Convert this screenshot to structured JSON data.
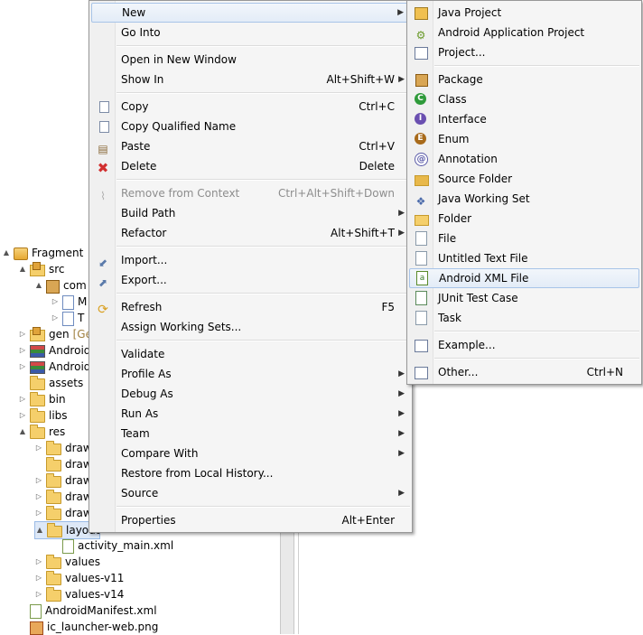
{
  "tree": {
    "rows": [
      {
        "label": "Fragment",
        "twisty": "▲",
        "icon": "project-icon"
      },
      {
        "label": "src",
        "twisty": "▲",
        "icon": "source-folder-icon"
      },
      {
        "label": "com",
        "twisty": "▲",
        "icon": "package-icon"
      },
      {
        "label": "M",
        "twisty": "▷",
        "icon": "java-file-icon"
      },
      {
        "label": "T",
        "twisty": "▷",
        "icon": "java-file-icon"
      },
      {
        "label": "gen",
        "suffix": "[Ge",
        "twisty": "▷",
        "icon": "source-folder-icon"
      },
      {
        "label": "Android",
        "twisty": "▷",
        "icon": "library-icon"
      },
      {
        "label": "Android",
        "twisty": "▷",
        "icon": "library-icon"
      },
      {
        "label": "assets",
        "twisty": "",
        "icon": "folder-icon"
      },
      {
        "label": "bin",
        "twisty": "▷",
        "icon": "folder-icon"
      },
      {
        "label": "libs",
        "twisty": "▷",
        "icon": "folder-icon"
      },
      {
        "label": "res",
        "twisty": "▲",
        "icon": "folder-icon"
      },
      {
        "label": "draw",
        "twisty": "▷",
        "icon": "folder-icon"
      },
      {
        "label": "draw",
        "twisty": "",
        "icon": "folder-icon"
      },
      {
        "label": "draw",
        "twisty": "▷",
        "icon": "folder-icon"
      },
      {
        "label": "draw",
        "twisty": "▷",
        "icon": "folder-icon"
      },
      {
        "label": "draw",
        "twisty": "▷",
        "icon": "folder-icon"
      },
      {
        "label": "layout",
        "twisty": "▲",
        "icon": "folder-icon"
      },
      {
        "label": "activity_main.xml",
        "twisty": "",
        "icon": "xml-file-icon"
      },
      {
        "label": "values",
        "twisty": "▷",
        "icon": "folder-icon"
      },
      {
        "label": "values-v11",
        "twisty": "▷",
        "icon": "folder-icon"
      },
      {
        "label": "values-v14",
        "twisty": "▷",
        "icon": "folder-icon"
      },
      {
        "label": "AndroidManifest.xml",
        "twisty": "",
        "icon": "xml-file-icon"
      },
      {
        "label": "ic_launcher-web.png",
        "twisty": "",
        "icon": "png-file-icon"
      }
    ]
  },
  "context_menu": {
    "items": {
      "new": {
        "label": "New",
        "has_submenu": true
      },
      "go_into": {
        "label": "Go Into"
      },
      "open_new_window": {
        "label": "Open in New Window"
      },
      "show_in": {
        "label": "Show In",
        "shortcut": "Alt+Shift+W"
      },
      "copy": {
        "label": "Copy",
        "shortcut": "Ctrl+C",
        "icon": "copy-icon"
      },
      "copy_qualified": {
        "label": "Copy Qualified Name",
        "icon": "copy-qualified-icon"
      },
      "paste": {
        "label": "Paste",
        "shortcut": "Ctrl+V",
        "icon": "paste-icon"
      },
      "delete": {
        "label": "Delete",
        "shortcut": "Delete",
        "icon": "delete-icon"
      },
      "remove_context": {
        "label": "Remove from Context",
        "shortcut": "Ctrl+Alt+Shift+Down",
        "disabled": true,
        "icon": "remove-context-icon"
      },
      "build_path": {
        "label": "Build Path"
      },
      "refactor": {
        "label": "Refactor",
        "shortcut": "Alt+Shift+T"
      },
      "import": {
        "label": "Import...",
        "icon": "import-icon"
      },
      "export": {
        "label": "Export...",
        "icon": "export-icon"
      },
      "refresh": {
        "label": "Refresh",
        "shortcut": "F5",
        "icon": "refresh-icon"
      },
      "assign_sets": {
        "label": "Assign Working Sets..."
      },
      "validate": {
        "label": "Validate"
      },
      "profile_as": {
        "label": "Profile As"
      },
      "debug_as": {
        "label": "Debug As"
      },
      "run_as": {
        "label": "Run As"
      },
      "team": {
        "label": "Team"
      },
      "compare_with": {
        "label": "Compare With"
      },
      "restore_history": {
        "label": "Restore from Local History..."
      },
      "source": {
        "label": "Source"
      },
      "properties": {
        "label": "Properties",
        "shortcut": "Alt+Enter"
      }
    }
  },
  "submenu_new": {
    "items": {
      "java_project": {
        "label": "Java Project"
      },
      "android_app_project": {
        "label": "Android Application Project"
      },
      "project": {
        "label": "Project..."
      },
      "package": {
        "label": "Package"
      },
      "class": {
        "label": "Class"
      },
      "interface": {
        "label": "Interface"
      },
      "enum": {
        "label": "Enum"
      },
      "annotation": {
        "label": "Annotation"
      },
      "source_folder": {
        "label": "Source Folder"
      },
      "java_working_set": {
        "label": "Java Working Set"
      },
      "folder": {
        "label": "Folder"
      },
      "file": {
        "label": "File"
      },
      "untitled_text": {
        "label": "Untitled Text File"
      },
      "android_xml": {
        "label": "Android XML File",
        "highlighted": true
      },
      "junit": {
        "label": "JUnit Test Case"
      },
      "task": {
        "label": "Task"
      },
      "example": {
        "label": "Example..."
      },
      "other": {
        "label": "Other...",
        "shortcut": "Ctrl+N"
      }
    }
  },
  "colors": {
    "menu_background": "#f5f5f5",
    "highlight_border": "#a8c4e8",
    "disabled_text": "#8d8d8d"
  }
}
